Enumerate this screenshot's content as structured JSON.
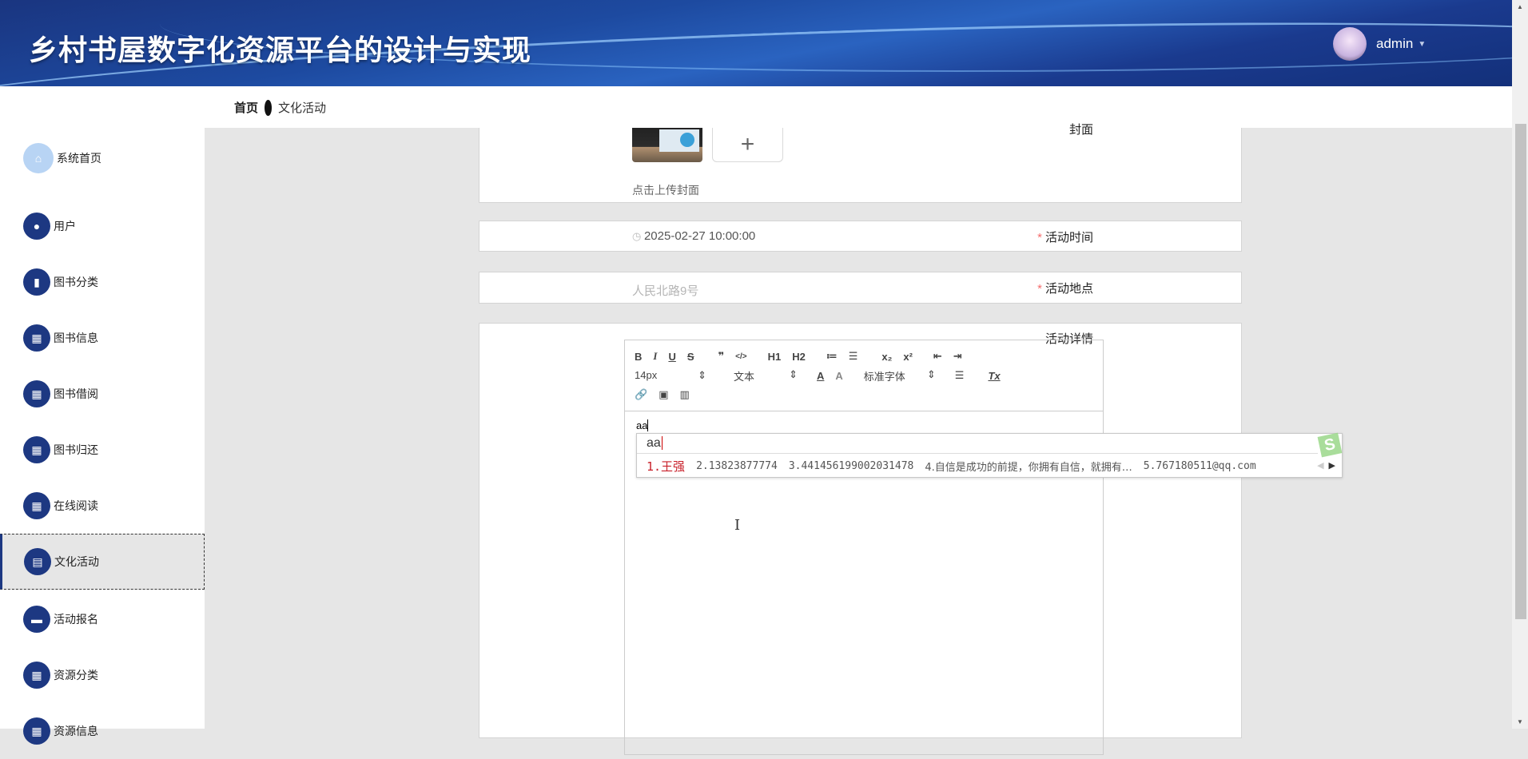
{
  "header": {
    "title": "乡村书屋数字化资源平台的设计与实现",
    "user": "admin"
  },
  "breadcrumb": {
    "home": "首页",
    "current": "文化活动"
  },
  "sidebar": {
    "items": [
      {
        "label": "系统首页",
        "icon": "home-icon"
      },
      {
        "label": "用户",
        "icon": "user-icon"
      },
      {
        "label": "图书分类",
        "icon": "bar-chart-icon"
      },
      {
        "label": "图书信息",
        "icon": "grid-icon"
      },
      {
        "label": "图书借阅",
        "icon": "grid-icon"
      },
      {
        "label": "图书归还",
        "icon": "grid-icon"
      },
      {
        "label": "在线阅读",
        "icon": "grid-icon"
      },
      {
        "label": "文化活动",
        "icon": "clipboard-icon"
      },
      {
        "label": "活动报名",
        "icon": "monitor-icon"
      },
      {
        "label": "资源分类",
        "icon": "grid-icon"
      },
      {
        "label": "资源信息",
        "icon": "grid-icon"
      }
    ]
  },
  "form": {
    "cover": {
      "label": "封面",
      "hint": "点击上传封面",
      "add": "+"
    },
    "time": {
      "label": "活动时间",
      "value": "2025-02-27 10:00:00"
    },
    "location": {
      "label": "活动地点",
      "placeholder": "人民北路9号"
    },
    "details": {
      "label": "活动详情",
      "content": "aa"
    }
  },
  "editor": {
    "row1": [
      "B",
      "I",
      "U",
      "S",
      "❞",
      "</>",
      "H1",
      "H2",
      "≔",
      "☰",
      "x₂",
      "x²",
      "⇤",
      "⇥"
    ],
    "font_size": "14px",
    "block": "文本",
    "font_family": "标准字体",
    "clear": "Tx"
  },
  "ime": {
    "composition": "aa",
    "candidates": [
      "1.王强",
      "2.13823877774",
      "3.441456199002031478",
      "4.自信是成功的前提，你拥有自信，就拥有…",
      "5.767180511@qq.com"
    ]
  }
}
